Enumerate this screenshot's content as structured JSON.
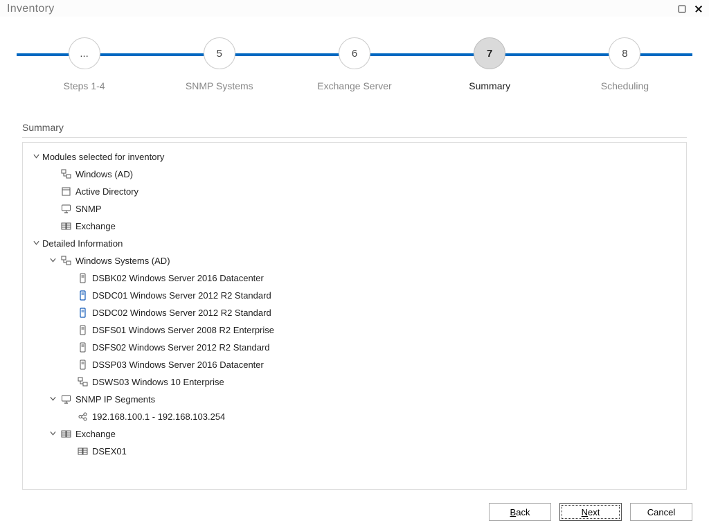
{
  "window": {
    "title": "Inventory"
  },
  "steps": [
    {
      "number": "...",
      "label": "Steps 1-4",
      "current": false
    },
    {
      "number": "5",
      "label": "SNMP Systems",
      "current": false
    },
    {
      "number": "6",
      "label": "Exchange Server",
      "current": false
    },
    {
      "number": "7",
      "label": "Summary",
      "current": true
    },
    {
      "number": "8",
      "label": "Scheduling",
      "current": false
    }
  ],
  "section_title": "Summary",
  "tree": [
    {
      "label": "Modules selected for inventory",
      "icon": null,
      "children": [
        {
          "label": "Windows (AD)",
          "icon": "network"
        },
        {
          "label": "Active Directory",
          "icon": "directory"
        },
        {
          "label": "SNMP",
          "icon": "monitor"
        },
        {
          "label": "Exchange",
          "icon": "exchange"
        }
      ]
    },
    {
      "label": "Detailed Information",
      "icon": null,
      "children": [
        {
          "label": "Windows Systems (AD)",
          "icon": "network",
          "children": [
            {
              "label": "DSBK02 Windows Server 2016 Datacenter",
              "icon": "server"
            },
            {
              "label": "DSDC01 Windows Server 2012 R2 Standard",
              "icon": "server-blue"
            },
            {
              "label": "DSDC02 Windows Server 2012 R2 Standard",
              "icon": "server-blue"
            },
            {
              "label": "DSFS01 Windows Server 2008 R2 Enterprise",
              "icon": "server"
            },
            {
              "label": "DSFS02 Windows Server 2012 R2 Standard",
              "icon": "server"
            },
            {
              "label": "DSSP03 Windows Server 2016 Datacenter",
              "icon": "server"
            },
            {
              "label": "DSWS03 Windows 10 Enterprise",
              "icon": "network"
            }
          ]
        },
        {
          "label": "SNMP IP Segments",
          "icon": "monitor",
          "children": [
            {
              "label": "192.168.100.1 - 192.168.103.254",
              "icon": "segment"
            }
          ]
        },
        {
          "label": "Exchange",
          "icon": "exchange",
          "children": [
            {
              "label": "DSEX01",
              "icon": "exchange"
            }
          ]
        }
      ]
    }
  ],
  "buttons": {
    "back": "Back",
    "next": "Next",
    "cancel": "Cancel"
  }
}
